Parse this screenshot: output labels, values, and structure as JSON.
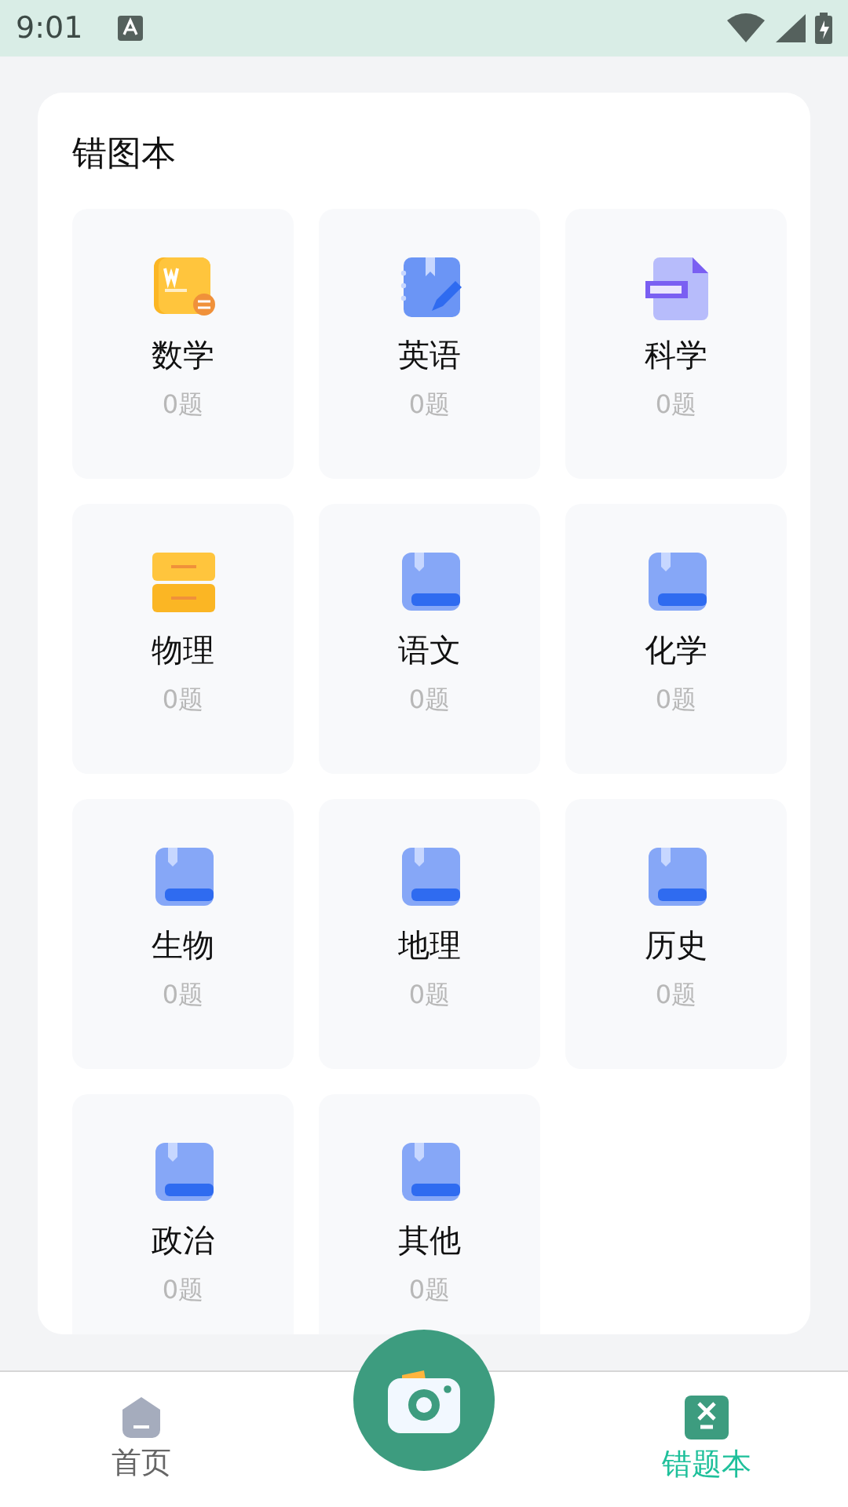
{
  "status_bar": {
    "time": "9:01"
  },
  "card": {
    "title": "错图本",
    "subjects": [
      {
        "name": "数学",
        "count": "0题",
        "kind": "word"
      },
      {
        "name": "英语",
        "count": "0题",
        "kind": "notebook"
      },
      {
        "name": "科学",
        "count": "0题",
        "kind": "ppt"
      },
      {
        "name": "物理",
        "count": "0题",
        "kind": "folder"
      },
      {
        "name": "语文",
        "count": "0题",
        "kind": "book"
      },
      {
        "name": "化学",
        "count": "0题",
        "kind": "book"
      },
      {
        "name": "生物",
        "count": "0题",
        "kind": "book"
      },
      {
        "name": "地理",
        "count": "0题",
        "kind": "book"
      },
      {
        "name": "历史",
        "count": "0题",
        "kind": "book"
      },
      {
        "name": "政治",
        "count": "0题",
        "kind": "book"
      },
      {
        "name": "其他",
        "count": "0题",
        "kind": "book"
      }
    ]
  },
  "bottom_nav": {
    "tabs": [
      {
        "label": "首页",
        "kind": "home",
        "selected": false
      },
      {
        "label": "错题本",
        "kind": "notebook",
        "selected": true
      }
    ]
  }
}
